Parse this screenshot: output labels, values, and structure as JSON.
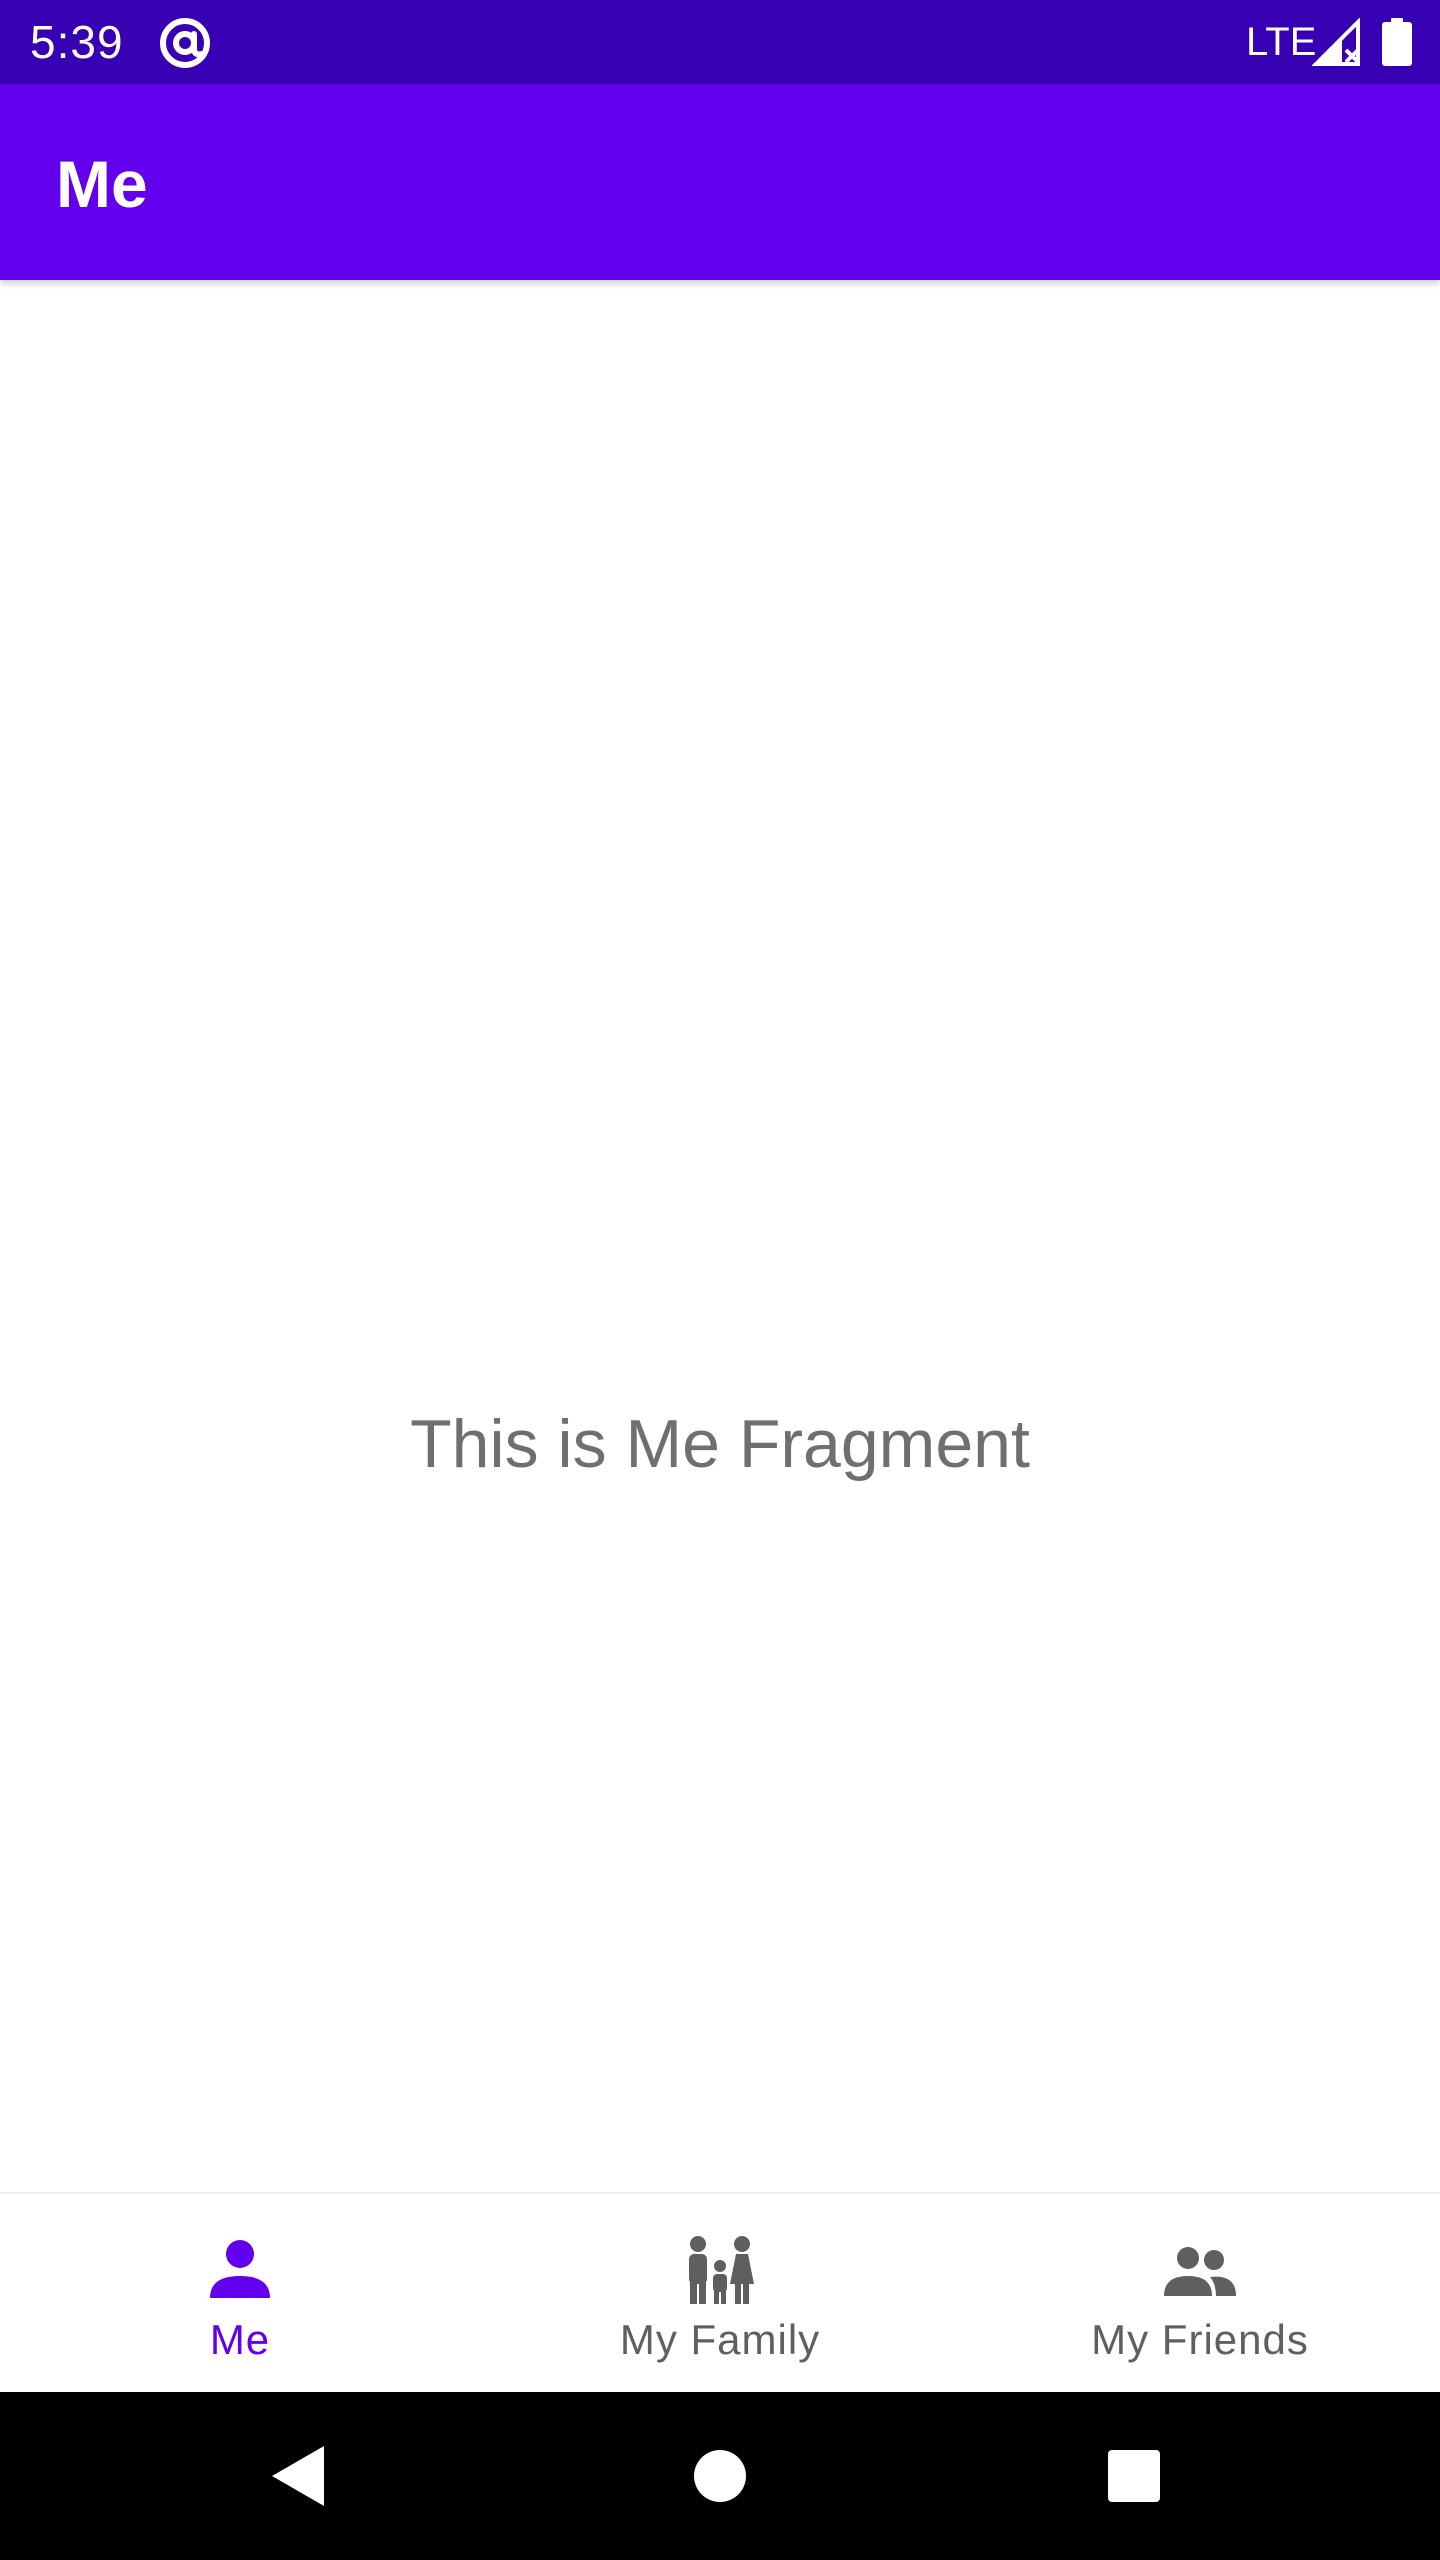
{
  "status_bar": {
    "time": "5:39",
    "network": "LTE",
    "icons": [
      "at-sign-icon",
      "signal-icon",
      "battery-icon"
    ],
    "background": "#3700b3"
  },
  "app_bar": {
    "title": "Me",
    "background": "#6200ee"
  },
  "content": {
    "message": "This is Me Fragment",
    "text_color": "#6f6f6f"
  },
  "bottom_nav": {
    "active_color": "#6200ee",
    "inactive_color": "#5f5f5f",
    "items": [
      {
        "label": "Me",
        "icon": "person-icon",
        "active": true
      },
      {
        "label": "My Family",
        "icon": "family-icon",
        "active": false
      },
      {
        "label": "My Friends",
        "icon": "people-icon",
        "active": false
      }
    ]
  },
  "system_nav": {
    "buttons": [
      "back-icon",
      "home-icon",
      "recents-icon"
    ]
  }
}
